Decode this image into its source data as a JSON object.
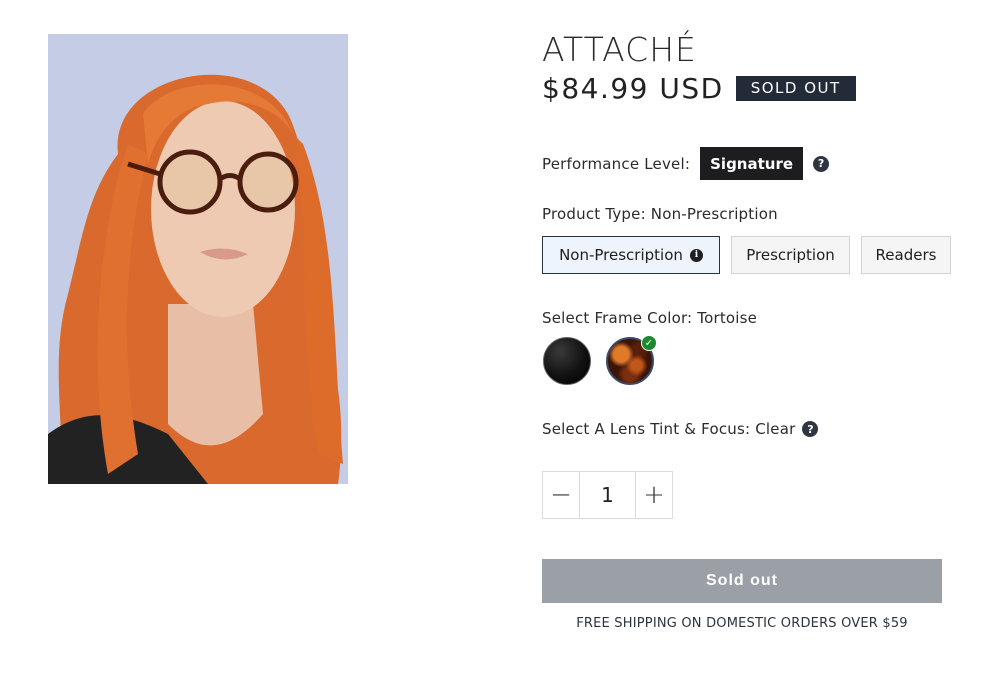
{
  "product": {
    "title": "ATTACHÉ",
    "price": "$84.99 USD",
    "badge": "SOLD OUT"
  },
  "performance": {
    "label": "Performance Level:",
    "value": "Signature",
    "help_icon": "?"
  },
  "product_type": {
    "label": "Product Type: Non-Prescription",
    "options": [
      {
        "label": "Non-Prescription",
        "selected": true,
        "info_icon": "i"
      },
      {
        "label": "Prescription",
        "selected": false
      },
      {
        "label": "Readers",
        "selected": false
      }
    ]
  },
  "frame_color": {
    "label": "Select Frame Color: Tortoise",
    "swatches": [
      {
        "name": "Black",
        "color": "#000000",
        "selected": false
      },
      {
        "name": "Tortoise",
        "color": "#6b2a0e",
        "selected": true
      }
    ],
    "check_icon": "✓"
  },
  "lens": {
    "label": "Select A Lens Tint & Focus: Clear",
    "help_icon": "?"
  },
  "quantity": {
    "minus": "−",
    "value": "1",
    "plus": "+"
  },
  "cta": {
    "label": "Sold out"
  },
  "shipping_note": "FREE SHIPPING ON DOMESTIC ORDERS OVER $59",
  "colors": {
    "badge_bg": "#232b38",
    "button_disabled": "#9aa0a6",
    "check_green": "#1b8a2e"
  }
}
